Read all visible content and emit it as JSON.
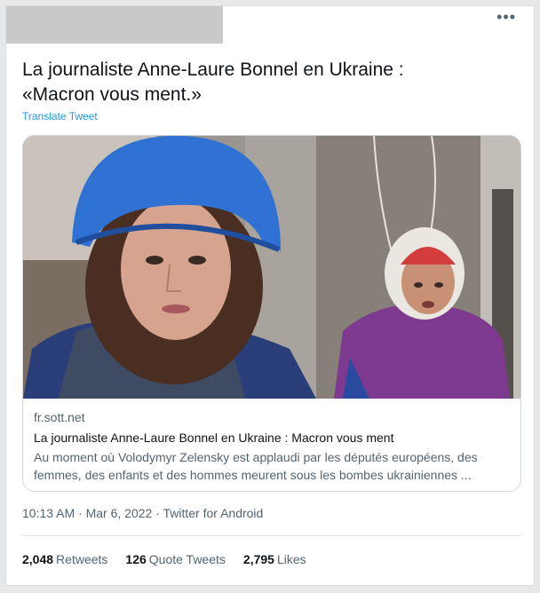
{
  "tweet": {
    "more_icon": "more-horizontal-icon",
    "text_line1": "La journaliste Anne-Laure Bonnel en Ukraine :",
    "text_line2": "«Macron vous ment.»",
    "translate_label": "Translate Tweet",
    "link_card": {
      "domain": "fr.sott.net",
      "title": "La journaliste Anne-Laure Bonnel en Ukraine : Macron vous ment",
      "description_line1": "Au moment où Volodymyr Zelensky est applaudi par les députés européens, des",
      "description_line2": "femmes, des enfants et des hommes meurent sous les bombes ukrainiennes ..."
    },
    "timestamp": "10:13 AM · Mar 6, 2022 · Twitter for Android",
    "stats": {
      "retweets_count": "2,048",
      "retweets_label": "Retweets",
      "quotes_count": "126",
      "quotes_label": "Quote Tweets",
      "likes_count": "2,795",
      "likes_label": "Likes"
    }
  },
  "colors": {
    "link_blue": "#1d9bf0",
    "helmet_blue": "#2f72d4",
    "jacket_purple": "#7d3a8f"
  }
}
